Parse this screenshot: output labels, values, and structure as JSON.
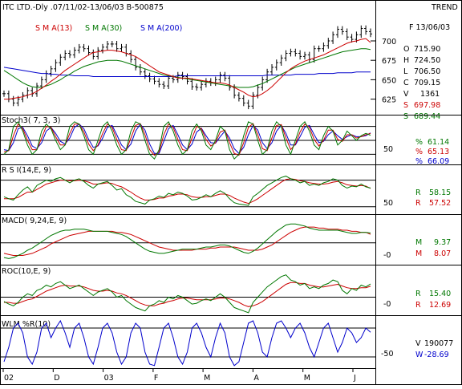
{
  "header": {
    "title": "ITC LTD.-Dly .07/11/02-13/06/03  B-500875",
    "trend_label": "TREND",
    "date_label": "F 13/06/03"
  },
  "sma_legend": [
    {
      "label": "S M A(13)",
      "color": "#cc0000"
    },
    {
      "label": "S M A(30)",
      "color": "#007700"
    },
    {
      "label": "S M A(200)",
      "color": "#0000cc"
    }
  ],
  "price_readout": [
    {
      "label": "O",
      "value": "715.90",
      "color": "#000000"
    },
    {
      "label": "H",
      "value": "724.50",
      "color": "#000000"
    },
    {
      "label": "L",
      "value": "706.50",
      "color": "#000000"
    },
    {
      "label": "C",
      "value": "709.15",
      "color": "#000000"
    },
    {
      "label": "V",
      "value": "1361",
      "color": "#000000"
    },
    {
      "label": "S",
      "value": "697.98",
      "color": "#cc0000"
    },
    {
      "label": "S",
      "value": "689.44",
      "color": "#007700"
    }
  ],
  "indicators": {
    "stoch": {
      "title": "Stoch3( 7, 3, 3)",
      "axis_label": "50",
      "readout": [
        {
          "label": "%",
          "value": "61.14",
          "color": "#007700"
        },
        {
          "label": "%",
          "value": "65.13",
          "color": "#cc0000"
        },
        {
          "label": "%",
          "value": "66.09",
          "color": "#0000cc"
        }
      ]
    },
    "rsi": {
      "title": "R S I(14,E, 9)",
      "axis_label": "50",
      "readout": [
        {
          "label": "R",
          "value": "58.15",
          "color": "#007700"
        },
        {
          "label": "R",
          "value": "57.52",
          "color": "#cc0000"
        }
      ]
    },
    "macd": {
      "title": "MACD( 9,24,E, 9)",
      "axis_label": "-0",
      "readout": [
        {
          "label": "M",
          "value": "9.37",
          "color": "#007700"
        },
        {
          "label": "M",
          "value": "8.07",
          "color": "#cc0000"
        }
      ]
    },
    "roc": {
      "title": "ROC(10,E, 9)",
      "axis_label": "-0",
      "readout": [
        {
          "label": "R",
          "value": "15.40",
          "color": "#007700"
        },
        {
          "label": "R",
          "value": "12.69",
          "color": "#cc0000"
        }
      ]
    },
    "wlm": {
      "title": "WLM %R(10)",
      "axis_label": "-50",
      "readout": [
        {
          "label": "V",
          "value": "190077",
          "color": "#000000"
        },
        {
          "label": "W",
          "value": "-28.69",
          "color": "#0000cc"
        }
      ]
    }
  },
  "colors": {
    "price_bars": "#000000",
    "sma13": "#cc0000",
    "sma30": "#007700",
    "sma200": "#0000cc",
    "frame": "#000000"
  },
  "chart_data": {
    "type": "line",
    "x_tick_labels": [
      "02",
      "D",
      "03",
      "F",
      "M",
      "A",
      "M",
      "J"
    ],
    "price_axis_ticks": [
      700,
      675,
      650,
      625
    ],
    "price_ylim": [
      608,
      730
    ],
    "price_close": [
      632,
      625,
      620,
      625,
      630,
      636,
      632,
      642,
      650,
      658,
      664,
      672,
      679,
      684,
      682,
      688,
      692,
      690,
      685,
      680,
      688,
      692,
      696,
      696,
      690,
      692,
      684,
      676,
      666,
      660,
      655,
      651,
      648,
      644,
      642,
      652,
      650,
      656,
      654,
      648,
      641,
      640,
      644,
      648,
      646,
      650,
      656,
      652,
      640,
      630,
      626,
      620,
      616,
      630,
      640,
      650,
      660,
      666,
      672,
      678,
      684,
      686,
      684,
      680,
      682,
      676,
      690,
      690,
      694,
      700,
      708,
      715,
      712,
      705,
      702,
      708,
      716,
      712,
      709
    ],
    "sma13": [
      625,
      625,
      626,
      627,
      628,
      630,
      632,
      635,
      639,
      643,
      648,
      652,
      657,
      662,
      666,
      670,
      674,
      678,
      682,
      685,
      686,
      687,
      688,
      688,
      687,
      686,
      684,
      682,
      680,
      676,
      672,
      668,
      664,
      660,
      658,
      656,
      654,
      652,
      652,
      652,
      651,
      650,
      649,
      648,
      647,
      646,
      646,
      645,
      643,
      640,
      637,
      634,
      630,
      628,
      629,
      632,
      636,
      641,
      647,
      653,
      659,
      664,
      668,
      671,
      674,
      676,
      678,
      680,
      682,
      685,
      688,
      691,
      694,
      697,
      699,
      700,
      702,
      703,
      698
    ],
    "sma30": [
      662,
      658,
      654,
      650,
      646,
      643,
      641,
      640,
      640,
      642,
      644,
      647,
      650,
      654,
      657,
      661,
      664,
      667,
      669,
      671,
      673,
      674,
      675,
      675,
      675,
      674,
      672,
      670,
      668,
      666,
      664,
      662,
      660,
      658,
      656,
      655,
      654,
      653,
      652,
      651,
      650,
      649,
      648,
      647,
      646,
      645,
      644,
      643,
      642,
      641,
      640,
      640,
      640,
      641,
      643,
      645,
      648,
      651,
      654,
      657,
      660,
      663,
      666,
      668,
      670,
      672,
      674,
      676,
      678,
      680,
      682,
      684,
      686,
      687,
      688,
      689,
      690,
      690,
      689
    ],
    "sma200": [
      666,
      665,
      664,
      663,
      662,
      661,
      660,
      659,
      658,
      658,
      657,
      657,
      656,
      656,
      656,
      655,
      655,
      655,
      655,
      654,
      654,
      654,
      654,
      654,
      654,
      654,
      654,
      654,
      654,
      654,
      654,
      654,
      654,
      654,
      654,
      654,
      654,
      655,
      655,
      655,
      655,
      655,
      655,
      655,
      655,
      655,
      655,
      655,
      655,
      655,
      655,
      655,
      655,
      655,
      655,
      655,
      656,
      656,
      656,
      656,
      656,
      656,
      657,
      657,
      657,
      657,
      657,
      658,
      658,
      658,
      658,
      659,
      659,
      659,
      659,
      660,
      660,
      660,
      660
    ],
    "stoch": {
      "ylim": [
        0,
        100
      ],
      "band_levels": [
        80,
        50,
        20
      ],
      "k": [
        20,
        30,
        80,
        90,
        70,
        40,
        20,
        30,
        70,
        85,
        75,
        50,
        30,
        40,
        80,
        90,
        85,
        60,
        30,
        20,
        50,
        80,
        90,
        70,
        40,
        20,
        30,
        70,
        90,
        85,
        50,
        20,
        10,
        30,
        80,
        90,
        70,
        40,
        20,
        30,
        70,
        85,
        70,
        40,
        30,
        50,
        80,
        70,
        30,
        10,
        20,
        60,
        90,
        85,
        50,
        20,
        30,
        70,
        90,
        80,
        40,
        20,
        50,
        80,
        90,
        70,
        40,
        30,
        60,
        80,
        70,
        40,
        50,
        70,
        60,
        50,
        60,
        65,
        61
      ],
      "d": [
        25,
        28,
        60,
        85,
        75,
        50,
        30,
        30,
        55,
        80,
        78,
        58,
        40,
        40,
        65,
        85,
        85,
        68,
        42,
        28,
        40,
        65,
        85,
        78,
        52,
        30,
        28,
        55,
        82,
        86,
        62,
        30,
        18,
        25,
        62,
        85,
        78,
        52,
        30,
        28,
        55,
        80,
        75,
        52,
        38,
        45,
        68,
        72,
        45,
        22,
        18,
        45,
        78,
        86,
        62,
        32,
        28,
        55,
        82,
        84,
        55,
        30,
        42,
        68,
        85,
        78,
        52,
        38,
        50,
        72,
        72,
        52,
        48,
        62,
        62,
        55,
        58,
        62,
        65
      ],
      "s": [
        30,
        28,
        45,
        75,
        78,
        60,
        38,
        32,
        45,
        70,
        78,
        65,
        48,
        42,
        55,
        78,
        85,
        75,
        52,
        35,
        38,
        55,
        78,
        82,
        62,
        40,
        30,
        42,
        70,
        85,
        72,
        42,
        22,
        22,
        48,
        75,
        82,
        62,
        40,
        30,
        42,
        68,
        76,
        60,
        45,
        44,
        58,
        70,
        55,
        32,
        22,
        35,
        62,
        82,
        72,
        45,
        32,
        45,
        70,
        82,
        65,
        40,
        40,
        58,
        78,
        82,
        62,
        45,
        48,
        62,
        70,
        60,
        52,
        58,
        62,
        58,
        58,
        60,
        66
      ]
    },
    "rsi": {
      "ylim": [
        20,
        90
      ],
      "band_levels": [
        70,
        30
      ],
      "rsi": [
        45,
        42,
        40,
        48,
        55,
        60,
        52,
        62,
        66,
        70,
        68,
        72,
        74,
        70,
        66,
        70,
        72,
        68,
        62,
        58,
        64,
        66,
        68,
        62,
        55,
        57,
        48,
        44,
        38,
        36,
        34,
        40,
        42,
        46,
        44,
        50,
        48,
        52,
        50,
        46,
        40,
        41,
        44,
        48,
        45,
        50,
        54,
        50,
        42,
        36,
        34,
        33,
        32,
        45,
        50,
        56,
        62,
        66,
        70,
        74,
        76,
        72,
        70,
        66,
        68,
        62,
        64,
        62,
        66,
        68,
        72,
        70,
        62,
        58,
        61,
        60,
        64,
        60,
        58
      ],
      "signal": [
        42,
        42,
        42,
        44,
        48,
        52,
        52,
        56,
        60,
        64,
        66,
        68,
        70,
        70,
        69,
        69,
        70,
        69,
        67,
        64,
        64,
        65,
        66,
        65,
        62,
        60,
        56,
        52,
        47,
        43,
        40,
        40,
        41,
        43,
        43,
        46,
        47,
        49,
        49,
        48,
        45,
        44,
        44,
        45,
        45,
        47,
        49,
        49,
        47,
        43,
        40,
        37,
        35,
        38,
        42,
        47,
        52,
        57,
        62,
        67,
        71,
        72,
        71,
        69,
        68,
        66,
        65,
        64,
        64,
        65,
        67,
        68,
        66,
        63,
        62,
        61,
        62,
        61,
        57.5
      ]
    },
    "macd": {
      "ylim": [
        -20,
        25
      ],
      "zero_line": 0,
      "macd": [
        -14,
        -15,
        -14,
        -12,
        -10,
        -7,
        -5,
        -2,
        1,
        4,
        7,
        9,
        11,
        12,
        12,
        13,
        13,
        13,
        12,
        11,
        11,
        11,
        11,
        10,
        9,
        8,
        6,
        3,
        0,
        -3,
        -6,
        -8,
        -9,
        -10,
        -10,
        -9,
        -8,
        -7,
        -6,
        -6,
        -6,
        -6,
        -5,
        -4,
        -4,
        -3,
        -2,
        -2,
        -3,
        -5,
        -7,
        -9,
        -10,
        -8,
        -5,
        -1,
        3,
        7,
        11,
        14,
        17,
        18,
        18,
        17,
        16,
        14,
        13,
        12,
        12,
        12,
        12,
        12,
        11,
        10,
        9,
        9,
        10,
        10,
        9.4
      ],
      "signal": [
        -10,
        -11,
        -12,
        -12,
        -12,
        -11,
        -10,
        -8,
        -6,
        -4,
        -1,
        1,
        3,
        5,
        7,
        8,
        9,
        10,
        11,
        11,
        11,
        11,
        11,
        11,
        10,
        10,
        9,
        8,
        6,
        4,
        2,
        0,
        -2,
        -4,
        -5,
        -6,
        -7,
        -7,
        -7,
        -7,
        -7,
        -6,
        -6,
        -6,
        -5,
        -5,
        -4,
        -4,
        -4,
        -4,
        -5,
        -6,
        -7,
        -7,
        -7,
        -6,
        -4,
        -2,
        1,
        4,
        7,
        10,
        12,
        14,
        15,
        15,
        15,
        14,
        14,
        13,
        13,
        13,
        12,
        12,
        11,
        11,
        10,
        10,
        8.1
      ]
    },
    "roc": {
      "ylim": [
        -20,
        35
      ],
      "zero_line": 0,
      "roc": [
        -5,
        -8,
        -10,
        -6,
        0,
        4,
        2,
        8,
        10,
        14,
        12,
        16,
        18,
        14,
        10,
        12,
        14,
        10,
        6,
        2,
        6,
        8,
        10,
        6,
        0,
        2,
        -4,
        -8,
        -12,
        -14,
        -16,
        -10,
        -8,
        -4,
        -6,
        0,
        -2,
        2,
        0,
        -4,
        -8,
        -7,
        -4,
        -2,
        -4,
        0,
        4,
        0,
        -6,
        -12,
        -14,
        -16,
        -18,
        -6,
        0,
        6,
        12,
        16,
        20,
        24,
        26,
        20,
        18,
        14,
        16,
        10,
        12,
        10,
        14,
        16,
        20,
        18,
        8,
        4,
        10,
        8,
        14,
        12,
        15.4
      ],
      "signal": [
        -6,
        -6,
        -7,
        -7,
        -5,
        -3,
        -2,
        1,
        4,
        7,
        9,
        11,
        13,
        14,
        13,
        13,
        13,
        12,
        10,
        8,
        7,
        7,
        8,
        7,
        5,
        4,
        2,
        -1,
        -4,
        -7,
        -9,
        -10,
        -10,
        -8,
        -7,
        -5,
        -4,
        -2,
        -1,
        -1,
        -2,
        -3,
        -3,
        -3,
        -3,
        -2,
        -1,
        -1,
        -2,
        -4,
        -6,
        -9,
        -11,
        -10,
        -8,
        -5,
        -1,
        3,
        7,
        11,
        15,
        17,
        17,
        16,
        16,
        14,
        13,
        12,
        12,
        13,
        14,
        15,
        13,
        11,
        10,
        10,
        11,
        11,
        12.7
      ]
    },
    "wlm": {
      "ylim": [
        -100,
        0
      ],
      "band_levels": [
        -20,
        -80
      ],
      "values": [
        -90,
        -60,
        -20,
        -10,
        -30,
        -80,
        -95,
        -70,
        -20,
        -10,
        -40,
        -20,
        -5,
        -30,
        -60,
        -20,
        -10,
        -40,
        -80,
        -95,
        -60,
        -20,
        -10,
        -30,
        -70,
        -95,
        -80,
        -30,
        -10,
        -20,
        -70,
        -95,
        -98,
        -60,
        -20,
        -10,
        -40,
        -80,
        -95,
        -70,
        -20,
        -10,
        -30,
        -60,
        -80,
        -40,
        -10,
        -30,
        -80,
        -98,
        -90,
        -50,
        -10,
        -5,
        -30,
        -70,
        -80,
        -40,
        -10,
        -5,
        -20,
        -40,
        -20,
        -10,
        -30,
        -60,
        -80,
        -50,
        -20,
        -10,
        -40,
        -70,
        -50,
        -20,
        -30,
        -50,
        -40,
        -20,
        -28.69
      ]
    }
  }
}
